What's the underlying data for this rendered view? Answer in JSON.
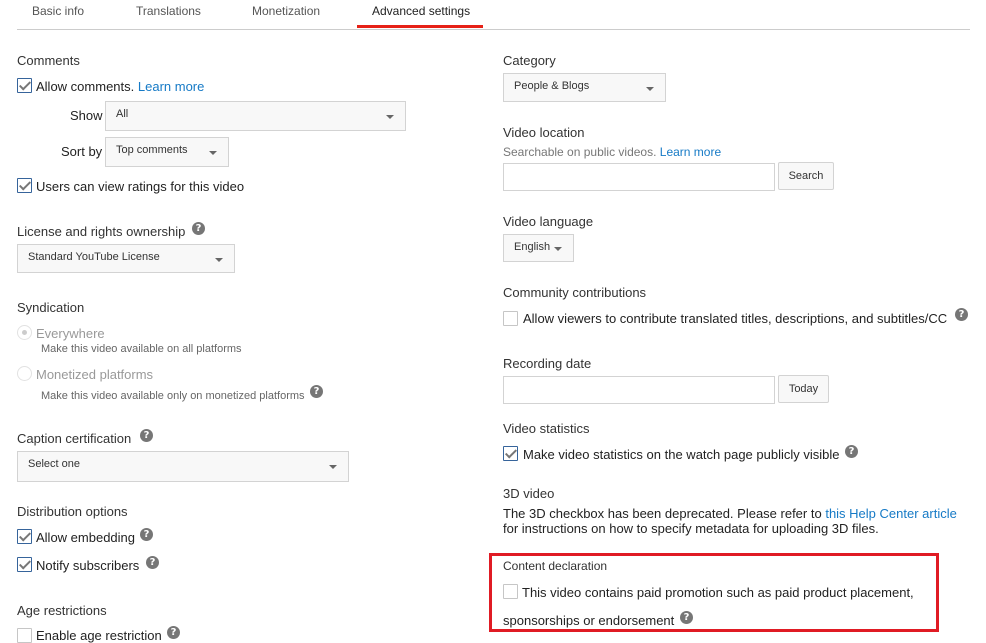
{
  "tabs": [
    {
      "label": "Basic info",
      "active": false
    },
    {
      "label": "Translations",
      "active": false
    },
    {
      "label": "Monetization",
      "active": false
    },
    {
      "label": "Advanced settings",
      "active": true
    }
  ],
  "accent_color": "#e62117",
  "highlight_color": "#e01b24",
  "left": {
    "comments": {
      "heading": "Comments",
      "allow_comments": {
        "label": "Allow comments.",
        "link": "Learn more",
        "checked": true
      },
      "show": {
        "label": "Show",
        "value": "All"
      },
      "sort_by": {
        "label": "Sort by",
        "value": "Top comments"
      },
      "ratings": {
        "label": "Users can view ratings for this video",
        "checked": true
      }
    },
    "license": {
      "heading": "License and rights ownership",
      "value": "Standard YouTube License"
    },
    "syndication": {
      "heading": "Syndication",
      "options": [
        {
          "label": "Everywhere",
          "description": "Make this video available on all platforms",
          "selected": true
        },
        {
          "label": "Monetized platforms",
          "description": "Make this video available only on monetized platforms",
          "selected": false
        }
      ]
    },
    "caption": {
      "heading": "Caption certification",
      "value": "Select one"
    },
    "distribution": {
      "heading": "Distribution options",
      "embedding": {
        "label": "Allow embedding",
        "checked": true
      },
      "notify": {
        "label": "Notify subscribers",
        "checked": true
      }
    },
    "age": {
      "heading": "Age restrictions",
      "enable": {
        "label": "Enable age restriction",
        "checked": false
      }
    }
  },
  "right": {
    "category": {
      "heading": "Category",
      "value": "People & Blogs"
    },
    "location": {
      "heading": "Video location",
      "hint": "Searchable on public videos.",
      "link": "Learn more",
      "input_value": "",
      "button": "Search"
    },
    "language": {
      "heading": "Video language",
      "value": "English"
    },
    "community": {
      "heading": "Community contributions",
      "label": "Allow viewers to contribute translated titles, descriptions, and subtitles/CC",
      "checked": false
    },
    "recording": {
      "heading": "Recording date",
      "input_value": "",
      "button": "Today"
    },
    "statistics": {
      "heading": "Video statistics",
      "label": "Make video statistics on the watch page publicly visible",
      "checked": true
    },
    "video3d": {
      "heading": "3D video",
      "text_before": "The 3D checkbox has been deprecated. Please refer to",
      "link": "this Help Center article",
      "text_after": "for instructions on how to specify metadata for uploading 3D files."
    },
    "content_declaration": {
      "heading": "Content declaration",
      "line1": "This video contains paid promotion such as paid product placement,",
      "line2": "sponsorships or endorsement",
      "checked": false
    }
  },
  "icons": {
    "help": "?"
  }
}
